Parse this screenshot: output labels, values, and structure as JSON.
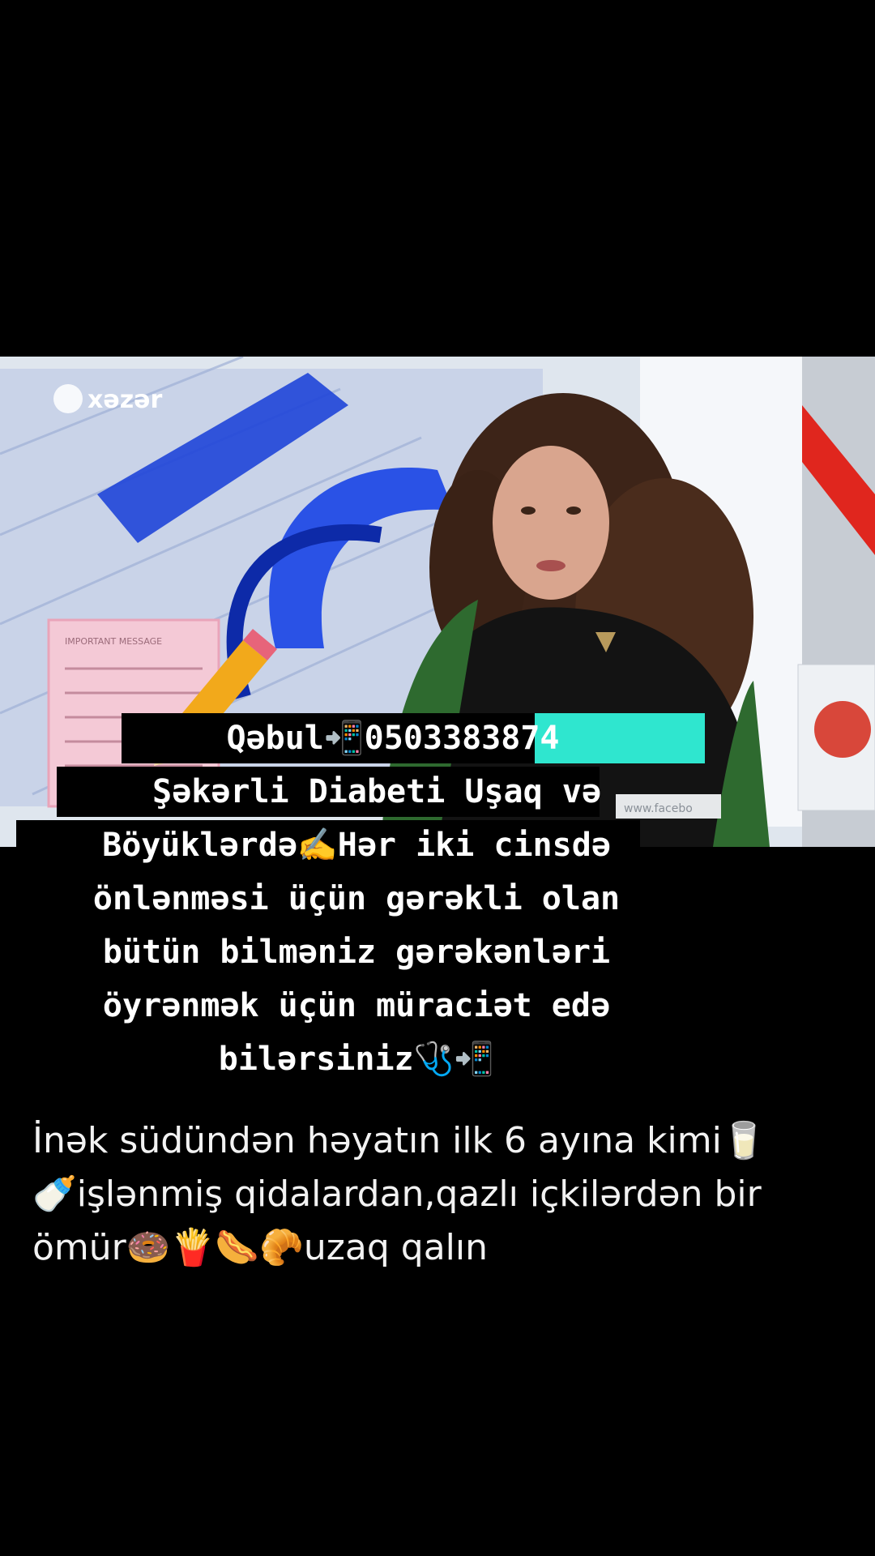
{
  "video_frame": {
    "channel_logo_text": "xəzər",
    "board_header_text": "IMPORTANT MESSAGE",
    "watermark_text": "www.facebo"
  },
  "overlay": {
    "lines": [
      "Qəbul📲0503383874",
      "Şəkərli Diabeti Uşaq və",
      "Böyüklərdə✍️Hər iki cinsdə",
      "önlənməsi üçün gərəkli olan",
      "bütün bilməniz gərəkənləri",
      "öyrənmək üçün müraciət edə",
      "bilərsiniz🩺📲"
    ]
  },
  "caption": {
    "line_1": "İnək südündən həyatın ilk 6 ayına  kimi🥛",
    "line_2": "🍼işlənmiş qidalardan,qazlı içkilərdən bir",
    "line_3": "ömür🍩🍟🌭🥐uzaq qalın"
  },
  "colors": {
    "background": "#000000",
    "highlight": "#2fe6cf",
    "text": "#ffffff"
  }
}
